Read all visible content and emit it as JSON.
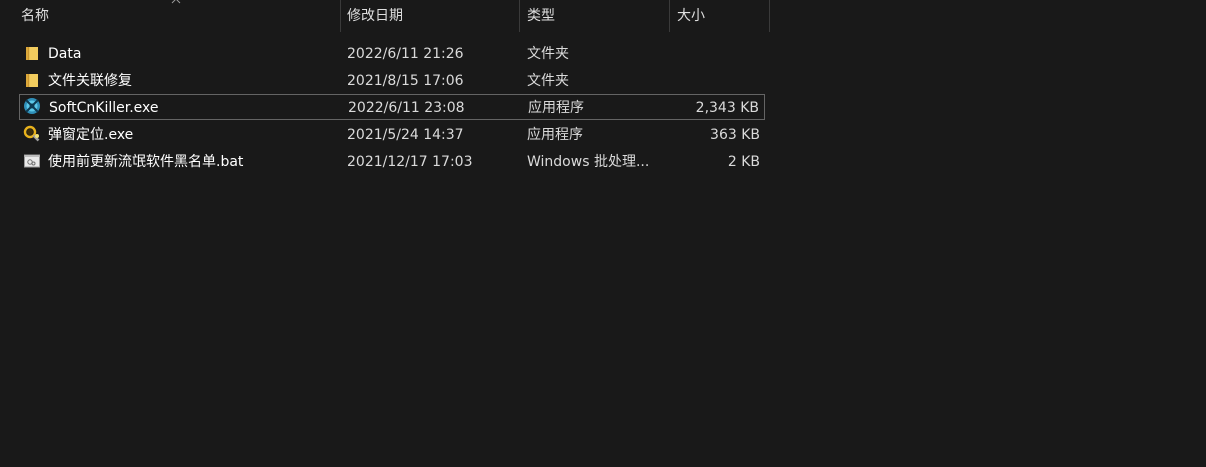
{
  "columns": {
    "name": "名称",
    "date": "修改日期",
    "type": "类型",
    "size": "大小"
  },
  "sort": {
    "column": "name",
    "direction": "ascending"
  },
  "files": [
    {
      "name": "Data",
      "date": "2022/6/11 21:26",
      "type": "文件夹",
      "size": "",
      "icon": "folder-icon"
    },
    {
      "name": "文件关联修复",
      "date": "2021/8/15 17:06",
      "type": "文件夹",
      "size": "",
      "icon": "folder-icon"
    },
    {
      "name": "SoftCnKiller.exe",
      "date": "2022/6/11 23:08",
      "type": "应用程序",
      "size": "2,343 KB",
      "icon": "softcnkiller-app-icon",
      "selected": true
    },
    {
      "name": "弹窗定位.exe",
      "date": "2021/5/24 14:37",
      "type": "应用程序",
      "size": "363 KB",
      "icon": "magnifier-app-icon"
    },
    {
      "name": "使用前更新流氓软件黑名单.bat",
      "date": "2021/12/17 17:03",
      "type": "Windows 批处理...",
      "size": "2 KB",
      "icon": "batch-file-icon"
    }
  ],
  "colors": {
    "background": "#191919",
    "folder": "#f0c85a",
    "selection_border": "#646464",
    "text": "#ffffff",
    "secondary_text": "#dadada"
  }
}
